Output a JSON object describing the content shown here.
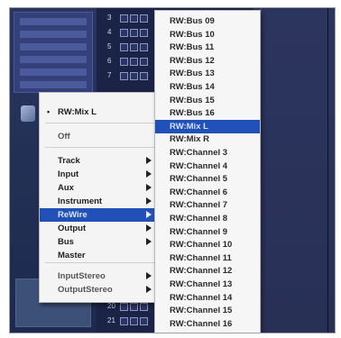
{
  "track_rows": [
    {
      "num": "3"
    },
    {
      "num": "4"
    },
    {
      "num": "5"
    },
    {
      "num": "6"
    },
    {
      "num": "7"
    },
    {
      "num": "20"
    },
    {
      "num": "21"
    }
  ],
  "main_menu": {
    "header": "RW:Mix L",
    "off": "Off",
    "items": [
      {
        "label": "Track",
        "submenu": true
      },
      {
        "label": "Input",
        "submenu": true
      },
      {
        "label": "Aux",
        "submenu": true
      },
      {
        "label": "Instrument",
        "submenu": true
      },
      {
        "label": "ReWire",
        "submenu": true,
        "selected": true
      },
      {
        "label": "Output",
        "submenu": true
      },
      {
        "label": "Bus",
        "submenu": true
      },
      {
        "label": "Master",
        "submenu": false
      }
    ],
    "stereo_items": [
      {
        "label": "InputStereo",
        "submenu": true
      },
      {
        "label": "OutputStereo",
        "submenu": true
      }
    ]
  },
  "sub_menu": {
    "items": [
      {
        "label": "RW:Bus 09"
      },
      {
        "label": "RW:Bus 10"
      },
      {
        "label": "RW:Bus 11"
      },
      {
        "label": "RW:Bus 12"
      },
      {
        "label": "RW:Bus 13"
      },
      {
        "label": "RW:Bus 14"
      },
      {
        "label": "RW:Bus 15"
      },
      {
        "label": "RW:Bus 16"
      },
      {
        "label": "RW:Mix L",
        "selected": true
      },
      {
        "label": "RW:Mix R"
      },
      {
        "label": "RW:Channel 3"
      },
      {
        "label": "RW:Channel 4"
      },
      {
        "label": "RW:Channel 5"
      },
      {
        "label": "RW:Channel 6"
      },
      {
        "label": "RW:Channel 7"
      },
      {
        "label": "RW:Channel 8"
      },
      {
        "label": "RW:Channel 9"
      },
      {
        "label": "RW:Channel 10"
      },
      {
        "label": "RW:Channel 11"
      },
      {
        "label": "RW:Channel 12"
      },
      {
        "label": "RW:Channel 13"
      },
      {
        "label": "RW:Channel 14"
      },
      {
        "label": "RW:Channel 15"
      },
      {
        "label": "RW:Channel 16"
      }
    ]
  },
  "colors": {
    "highlight": "#2150b8",
    "menu_bg": "#f4f4f4",
    "panel_bg": "#1b2447"
  }
}
